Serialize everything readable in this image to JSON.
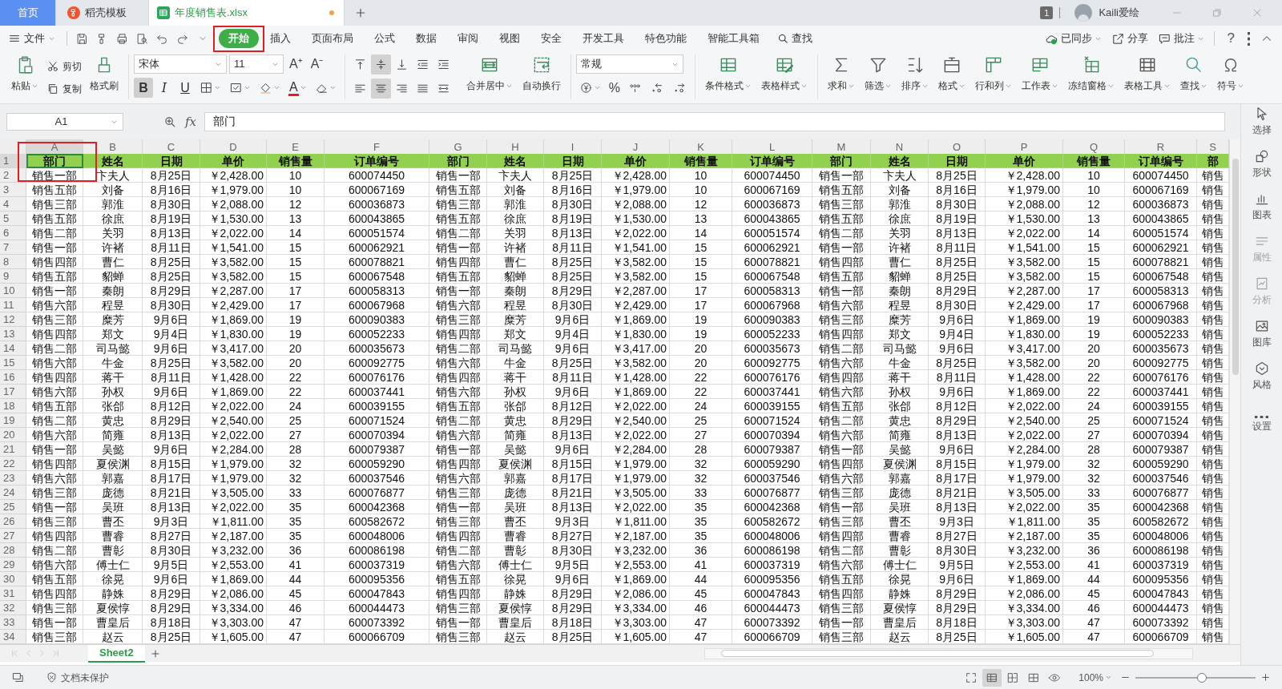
{
  "tabs": [
    {
      "label": "首页",
      "kind": "home",
      "selected": false
    },
    {
      "label": "稻壳模板",
      "kind": "template",
      "selected": false
    },
    {
      "label": "年度销售表.xlsx",
      "kind": "sheet",
      "selected": true,
      "unsaved": true
    }
  ],
  "account": {
    "badge": "1",
    "user": "Kaili爱绘"
  },
  "menu": {
    "file": "文件",
    "tabs": [
      {
        "label": "开始",
        "selected": true,
        "highlighted": true
      },
      {
        "label": "插入",
        "selected": false,
        "highlighted": false
      },
      {
        "label": "页面布局",
        "selected": false,
        "highlighted": false
      },
      {
        "label": "公式",
        "selected": false,
        "highlighted": false
      },
      {
        "label": "数据",
        "selected": false,
        "highlighted": false
      },
      {
        "label": "审阅",
        "selected": false,
        "highlighted": false
      },
      {
        "label": "视图",
        "selected": false,
        "highlighted": false
      },
      {
        "label": "安全",
        "selected": false,
        "highlighted": false
      },
      {
        "label": "开发工具",
        "selected": false,
        "highlighted": false
      },
      {
        "label": "特色功能",
        "selected": false,
        "highlighted": false
      },
      {
        "label": "智能工具箱",
        "selected": false,
        "highlighted": false
      }
    ],
    "search": "查找",
    "sync": "已同步",
    "share": "分享",
    "comment": "批注",
    "help": "?"
  },
  "ribbon": {
    "paste": "粘贴",
    "cut": "剪切",
    "copy": "复制",
    "format_painter": "格式刷",
    "font": {
      "name": "宋体",
      "size": "11",
      "grow": "A⁺",
      "shrink": "A⁻",
      "color_letter": "A"
    },
    "styles": [
      {
        "label": "B",
        "selected": true
      },
      {
        "label": "I",
        "selected": false
      },
      {
        "label": "U",
        "selected": false
      }
    ],
    "vertical_align": [
      {
        "selected": false
      },
      {
        "selected": true
      },
      {
        "selected": false
      }
    ],
    "horizontal_align": [
      {
        "selected": false
      },
      {
        "selected": true
      },
      {
        "selected": false
      }
    ],
    "merge": "合并居中",
    "wrap": "自动换行",
    "number_format": "常规",
    "percent": "%",
    "tools": [
      "条件格式",
      "表格样式",
      "求和",
      "筛选",
      "排序",
      "格式",
      "行和列",
      "工作表",
      "冻结窗格",
      "表格工具",
      "查找",
      "符号"
    ]
  },
  "formula_bar": {
    "cell": "A1",
    "fx": "fx",
    "value": "部门"
  },
  "sheet": {
    "columns": [
      {
        "label": "A",
        "selected": true
      },
      {
        "label": "B",
        "selected": false
      },
      {
        "label": "C",
        "selected": false
      },
      {
        "label": "D",
        "selected": false
      },
      {
        "label": "E",
        "selected": false
      },
      {
        "label": "F",
        "selected": false
      },
      {
        "label": "G",
        "selected": false
      },
      {
        "label": "H",
        "selected": false
      },
      {
        "label": "I",
        "selected": false
      },
      {
        "label": "J",
        "selected": false
      },
      {
        "label": "K",
        "selected": false
      },
      {
        "label": "L",
        "selected": false
      },
      {
        "label": "M",
        "selected": false
      },
      {
        "label": "N",
        "selected": false
      },
      {
        "label": "O",
        "selected": false
      },
      {
        "label": "P",
        "selected": false
      },
      {
        "label": "Q",
        "selected": false
      },
      {
        "label": "R",
        "selected": false
      },
      {
        "label": "S",
        "selected": false
      }
    ],
    "highlighted_cell": true,
    "rows": [
      {
        "number": "1",
        "kind": "header",
        "selected": true,
        "cells": [
          "部门",
          "姓名",
          "日期",
          "单价",
          "销售量",
          "订单编号",
          "部门",
          "姓名",
          "日期",
          "单价",
          "销售量",
          "订单编号",
          "部门",
          "姓名",
          "日期",
          "单价",
          "销售量",
          "订单编号",
          "部"
        ]
      },
      {
        "number": "2",
        "kind": "data",
        "selected": false,
        "cells": [
          "销售一部",
          "卞夫人",
          "8月25日",
          "￥2,428.00",
          "10",
          "600074450",
          "销售一部",
          "卞夫人",
          "8月25日",
          "￥2,428.00",
          "10",
          "600074450",
          "销售一部",
          "卞夫人",
          "8月25日",
          "￥2,428.00",
          "10",
          "600074450",
          "销售"
        ]
      },
      {
        "number": "3",
        "kind": "data",
        "selected": false,
        "cells": [
          "销售五部",
          "刘备",
          "8月16日",
          "￥1,979.00",
          "10",
          "600067169",
          "销售五部",
          "刘备",
          "8月16日",
          "￥1,979.00",
          "10",
          "600067169",
          "销售五部",
          "刘备",
          "8月16日",
          "￥1,979.00",
          "10",
          "600067169",
          "销售"
        ]
      },
      {
        "number": "4",
        "kind": "data",
        "selected": false,
        "cells": [
          "销售三部",
          "郭淮",
          "8月30日",
          "￥2,088.00",
          "12",
          "600036873",
          "销售三部",
          "郭淮",
          "8月30日",
          "￥2,088.00",
          "12",
          "600036873",
          "销售三部",
          "郭淮",
          "8月30日",
          "￥2,088.00",
          "12",
          "600036873",
          "销售"
        ]
      },
      {
        "number": "5",
        "kind": "data",
        "selected": false,
        "cells": [
          "销售五部",
          "徐庶",
          "8月19日",
          "￥1,530.00",
          "13",
          "600043865",
          "销售五部",
          "徐庶",
          "8月19日",
          "￥1,530.00",
          "13",
          "600043865",
          "销售五部",
          "徐庶",
          "8月19日",
          "￥1,530.00",
          "13",
          "600043865",
          "销售"
        ]
      },
      {
        "number": "6",
        "kind": "data",
        "selected": false,
        "cells": [
          "销售二部",
          "关羽",
          "8月13日",
          "￥2,022.00",
          "14",
          "600051574",
          "销售二部",
          "关羽",
          "8月13日",
          "￥2,022.00",
          "14",
          "600051574",
          "销售二部",
          "关羽",
          "8月13日",
          "￥2,022.00",
          "14",
          "600051574",
          "销售"
        ]
      },
      {
        "number": "7",
        "kind": "data",
        "selected": false,
        "cells": [
          "销售一部",
          "许褚",
          "8月11日",
          "￥1,541.00",
          "15",
          "600062921",
          "销售一部",
          "许褚",
          "8月11日",
          "￥1,541.00",
          "15",
          "600062921",
          "销售一部",
          "许褚",
          "8月11日",
          "￥1,541.00",
          "15",
          "600062921",
          "销售"
        ]
      },
      {
        "number": "8",
        "kind": "data",
        "selected": false,
        "cells": [
          "销售四部",
          "曹仁",
          "8月25日",
          "￥3,582.00",
          "15",
          "600078821",
          "销售四部",
          "曹仁",
          "8月25日",
          "￥3,582.00",
          "15",
          "600078821",
          "销售四部",
          "曹仁",
          "8月25日",
          "￥3,582.00",
          "15",
          "600078821",
          "销售"
        ]
      },
      {
        "number": "9",
        "kind": "data",
        "selected": false,
        "cells": [
          "销售五部",
          "貂蝉",
          "8月25日",
          "￥3,582.00",
          "15",
          "600067548",
          "销售五部",
          "貂蝉",
          "8月25日",
          "￥3,582.00",
          "15",
          "600067548",
          "销售五部",
          "貂蝉",
          "8月25日",
          "￥3,582.00",
          "15",
          "600067548",
          "销售"
        ]
      },
      {
        "number": "10",
        "kind": "data",
        "selected": false,
        "cells": [
          "销售一部",
          "秦朗",
          "8月29日",
          "￥2,287.00",
          "17",
          "600058313",
          "销售一部",
          "秦朗",
          "8月29日",
          "￥2,287.00",
          "17",
          "600058313",
          "销售一部",
          "秦朗",
          "8月29日",
          "￥2,287.00",
          "17",
          "600058313",
          "销售"
        ]
      },
      {
        "number": "11",
        "kind": "data",
        "selected": false,
        "cells": [
          "销售六部",
          "程昱",
          "8月30日",
          "￥2,429.00",
          "17",
          "600067968",
          "销售六部",
          "程昱",
          "8月30日",
          "￥2,429.00",
          "17",
          "600067968",
          "销售六部",
          "程昱",
          "8月30日",
          "￥2,429.00",
          "17",
          "600067968",
          "销售"
        ]
      },
      {
        "number": "12",
        "kind": "data",
        "selected": false,
        "cells": [
          "销售三部",
          "糜芳",
          "9月6日",
          "￥1,869.00",
          "19",
          "600090383",
          "销售三部",
          "糜芳",
          "9月6日",
          "￥1,869.00",
          "19",
          "600090383",
          "销售三部",
          "糜芳",
          "9月6日",
          "￥1,869.00",
          "19",
          "600090383",
          "销售"
        ]
      },
      {
        "number": "13",
        "kind": "data",
        "selected": false,
        "cells": [
          "销售四部",
          "郑文",
          "9月4日",
          "￥1,830.00",
          "19",
          "600052233",
          "销售四部",
          "郑文",
          "9月4日",
          "￥1,830.00",
          "19",
          "600052233",
          "销售四部",
          "郑文",
          "9月4日",
          "￥1,830.00",
          "19",
          "600052233",
          "销售"
        ]
      },
      {
        "number": "14",
        "kind": "data",
        "selected": false,
        "cells": [
          "销售二部",
          "司马懿",
          "9月6日",
          "￥3,417.00",
          "20",
          "600035673",
          "销售二部",
          "司马懿",
          "9月6日",
          "￥3,417.00",
          "20",
          "600035673",
          "销售二部",
          "司马懿",
          "9月6日",
          "￥3,417.00",
          "20",
          "600035673",
          "销售"
        ]
      },
      {
        "number": "15",
        "kind": "data",
        "selected": false,
        "cells": [
          "销售六部",
          "牛金",
          "8月25日",
          "￥3,582.00",
          "20",
          "600092775",
          "销售六部",
          "牛金",
          "8月25日",
          "￥3,582.00",
          "20",
          "600092775",
          "销售六部",
          "牛金",
          "8月25日",
          "￥3,582.00",
          "20",
          "600092775",
          "销售"
        ]
      },
      {
        "number": "16",
        "kind": "data",
        "selected": false,
        "cells": [
          "销售四部",
          "蒋干",
          "8月11日",
          "￥1,428.00",
          "22",
          "600076176",
          "销售四部",
          "蒋干",
          "8月11日",
          "￥1,428.00",
          "22",
          "600076176",
          "销售四部",
          "蒋干",
          "8月11日",
          "￥1,428.00",
          "22",
          "600076176",
          "销售"
        ]
      },
      {
        "number": "17",
        "kind": "data",
        "selected": false,
        "cells": [
          "销售六部",
          "孙权",
          "9月6日",
          "￥1,869.00",
          "22",
          "600037441",
          "销售六部",
          "孙权",
          "9月6日",
          "￥1,869.00",
          "22",
          "600037441",
          "销售六部",
          "孙权",
          "9月6日",
          "￥1,869.00",
          "22",
          "600037441",
          "销售"
        ]
      },
      {
        "number": "18",
        "kind": "data",
        "selected": false,
        "cells": [
          "销售五部",
          "张郃",
          "8月12日",
          "￥2,022.00",
          "24",
          "600039155",
          "销售五部",
          "张郃",
          "8月12日",
          "￥2,022.00",
          "24",
          "600039155",
          "销售五部",
          "张郃",
          "8月12日",
          "￥2,022.00",
          "24",
          "600039155",
          "销售"
        ]
      },
      {
        "number": "19",
        "kind": "data",
        "selected": false,
        "cells": [
          "销售二部",
          "黄忠",
          "8月29日",
          "￥2,540.00",
          "25",
          "600071524",
          "销售二部",
          "黄忠",
          "8月29日",
          "￥2,540.00",
          "25",
          "600071524",
          "销售二部",
          "黄忠",
          "8月29日",
          "￥2,540.00",
          "25",
          "600071524",
          "销售"
        ]
      },
      {
        "number": "20",
        "kind": "data",
        "selected": false,
        "cells": [
          "销售六部",
          "简雍",
          "8月13日",
          "￥2,022.00",
          "27",
          "600070394",
          "销售六部",
          "简雍",
          "8月13日",
          "￥2,022.00",
          "27",
          "600070394",
          "销售六部",
          "简雍",
          "8月13日",
          "￥2,022.00",
          "27",
          "600070394",
          "销售"
        ]
      },
      {
        "number": "21",
        "kind": "data",
        "selected": false,
        "cells": [
          "销售一部",
          "吴懿",
          "9月6日",
          "￥2,284.00",
          "28",
          "600079387",
          "销售一部",
          "吴懿",
          "9月6日",
          "￥2,284.00",
          "28",
          "600079387",
          "销售一部",
          "吴懿",
          "9月6日",
          "￥2,284.00",
          "28",
          "600079387",
          "销售"
        ]
      },
      {
        "number": "22",
        "kind": "data",
        "selected": false,
        "cells": [
          "销售四部",
          "夏侯渊",
          "8月15日",
          "￥1,979.00",
          "32",
          "600059290",
          "销售四部",
          "夏侯渊",
          "8月15日",
          "￥1,979.00",
          "32",
          "600059290",
          "销售四部",
          "夏侯渊",
          "8月15日",
          "￥1,979.00",
          "32",
          "600059290",
          "销售"
        ]
      },
      {
        "number": "23",
        "kind": "data",
        "selected": false,
        "cells": [
          "销售六部",
          "郭嘉",
          "8月17日",
          "￥1,979.00",
          "32",
          "600037546",
          "销售六部",
          "郭嘉",
          "8月17日",
          "￥1,979.00",
          "32",
          "600037546",
          "销售六部",
          "郭嘉",
          "8月17日",
          "￥1,979.00",
          "32",
          "600037546",
          "销售"
        ]
      },
      {
        "number": "24",
        "kind": "data",
        "selected": false,
        "cells": [
          "销售三部",
          "庞德",
          "8月21日",
          "￥3,505.00",
          "33",
          "600076877",
          "销售三部",
          "庞德",
          "8月21日",
          "￥3,505.00",
          "33",
          "600076877",
          "销售三部",
          "庞德",
          "8月21日",
          "￥3,505.00",
          "33",
          "600076877",
          "销售"
        ]
      },
      {
        "number": "25",
        "kind": "data",
        "selected": false,
        "cells": [
          "销售一部",
          "吴班",
          "8月13日",
          "￥2,022.00",
          "35",
          "600042368",
          "销售一部",
          "吴班",
          "8月13日",
          "￥2,022.00",
          "35",
          "600042368",
          "销售一部",
          "吴班",
          "8月13日",
          "￥2,022.00",
          "35",
          "600042368",
          "销售"
        ]
      },
      {
        "number": "26",
        "kind": "data",
        "selected": false,
        "cells": [
          "销售三部",
          "曹丕",
          "9月3日",
          "￥1,811.00",
          "35",
          "600582672",
          "销售三部",
          "曹丕",
          "9月3日",
          "￥1,811.00",
          "35",
          "600582672",
          "销售三部",
          "曹丕",
          "9月3日",
          "￥1,811.00",
          "35",
          "600582672",
          "销售"
        ]
      },
      {
        "number": "27",
        "kind": "data",
        "selected": false,
        "cells": [
          "销售四部",
          "曹睿",
          "8月27日",
          "￥2,187.00",
          "35",
          "600048006",
          "销售四部",
          "曹睿",
          "8月27日",
          "￥2,187.00",
          "35",
          "600048006",
          "销售四部",
          "曹睿",
          "8月27日",
          "￥2,187.00",
          "35",
          "600048006",
          "销售"
        ]
      },
      {
        "number": "28",
        "kind": "data",
        "selected": false,
        "cells": [
          "销售二部",
          "曹彰",
          "8月30日",
          "￥3,232.00",
          "36",
          "600086198",
          "销售二部",
          "曹彰",
          "8月30日",
          "￥3,232.00",
          "36",
          "600086198",
          "销售二部",
          "曹彰",
          "8月30日",
          "￥3,232.00",
          "36",
          "600086198",
          "销售"
        ]
      },
      {
        "number": "29",
        "kind": "data",
        "selected": false,
        "cells": [
          "销售六部",
          "傅士仁",
          "9月5日",
          "￥2,553.00",
          "41",
          "600037319",
          "销售六部",
          "傅士仁",
          "9月5日",
          "￥2,553.00",
          "41",
          "600037319",
          "销售六部",
          "傅士仁",
          "9月5日",
          "￥2,553.00",
          "41",
          "600037319",
          "销售"
        ]
      },
      {
        "number": "30",
        "kind": "data",
        "selected": false,
        "cells": [
          "销售五部",
          "徐晃",
          "9月6日",
          "￥1,869.00",
          "44",
          "600095356",
          "销售五部",
          "徐晃",
          "9月6日",
          "￥1,869.00",
          "44",
          "600095356",
          "销售五部",
          "徐晃",
          "9月6日",
          "￥1,869.00",
          "44",
          "600095356",
          "销售"
        ]
      },
      {
        "number": "31",
        "kind": "data",
        "selected": false,
        "cells": [
          "销售四部",
          "静姝",
          "8月29日",
          "￥2,086.00",
          "45",
          "600047843",
          "销售四部",
          "静姝",
          "8月29日",
          "￥2,086.00",
          "45",
          "600047843",
          "销售四部",
          "静姝",
          "8月29日",
          "￥2,086.00",
          "45",
          "600047843",
          "销售"
        ]
      },
      {
        "number": "32",
        "kind": "data",
        "selected": false,
        "cells": [
          "销售三部",
          "夏侯惇",
          "8月29日",
          "￥3,334.00",
          "46",
          "600044473",
          "销售三部",
          "夏侯惇",
          "8月29日",
          "￥3,334.00",
          "46",
          "600044473",
          "销售三部",
          "夏侯惇",
          "8月29日",
          "￥3,334.00",
          "46",
          "600044473",
          "销售"
        ]
      },
      {
        "number": "33",
        "kind": "data",
        "selected": false,
        "cells": [
          "销售一部",
          "曹皇后",
          "8月18日",
          "￥3,303.00",
          "47",
          "600073392",
          "销售一部",
          "曹皇后",
          "8月18日",
          "￥3,303.00",
          "47",
          "600073392",
          "销售一部",
          "曹皇后",
          "8月18日",
          "￥3,303.00",
          "47",
          "600073392",
          "销售"
        ]
      },
      {
        "number": "34",
        "kind": "data",
        "selected": false,
        "cells": [
          "销售三部",
          "赵云",
          "8月25日",
          "￥1,605.00",
          "47",
          "600066709",
          "销售三部",
          "赵云",
          "8月25日",
          "￥1,605.00",
          "47",
          "600066709",
          "销售三部",
          "赵云",
          "8月25日",
          "￥1,605.00",
          "47",
          "600066709",
          "销售"
        ]
      }
    ]
  },
  "sidebar": [
    {
      "label": "选择",
      "disabled": false
    },
    {
      "label": "形状",
      "disabled": false
    },
    {
      "label": "图表",
      "disabled": false
    },
    {
      "label": "属性",
      "disabled": true
    },
    {
      "label": "分析",
      "disabled": true
    },
    {
      "label": "图库",
      "disabled": false
    },
    {
      "label": "风格",
      "disabled": false
    },
    {
      "label": "设置",
      "disabled": false
    }
  ],
  "sheet_tabs": [
    {
      "label": "Sheet2",
      "selected": true
    }
  ],
  "status_bar": {
    "protection": "文档未保护",
    "views": [
      {
        "selected": false
      },
      {
        "selected": true
      },
      {
        "selected": false
      },
      {
        "selected": false
      },
      {
        "selected": false
      }
    ],
    "zoom": "100%",
    "zoom_level": {
      "level": 0.55
    }
  }
}
